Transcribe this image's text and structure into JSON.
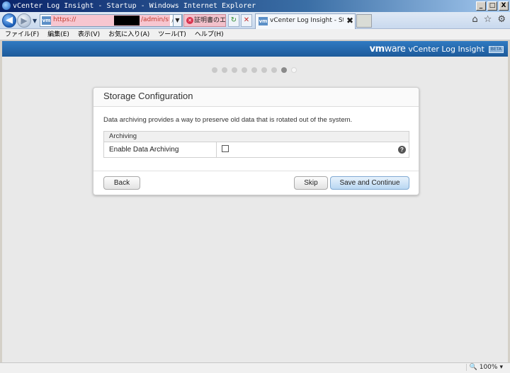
{
  "window": {
    "title": "vCenter Log Insight - Startup - Windows Internet Explorer",
    "min": "_",
    "max": "□",
    "close": "X"
  },
  "browser": {
    "url_prefix": "https://",
    "url_suffix": "/admin/startup#/admin/s",
    "search_glyph": "⌕",
    "cert_error": "証明書のエ...",
    "tab_title": "vCenter Log Insight - Start...",
    "tab_close": "✖",
    "vm_favicon": "vm",
    "icons": {
      "home": "home-icon",
      "star": "star-icon",
      "gear": "gear-icon"
    }
  },
  "menu": [
    "ファイル(F)",
    "編集(E)",
    "表示(V)",
    "お気に入り(A)",
    "ツール(T)",
    "ヘルプ(H)"
  ],
  "header": {
    "logo_vm": "vm",
    "logo_ware": "ware",
    "product": "vCenter Log Insight",
    "badge": "BETA",
    "accent": "#2a6fb6"
  },
  "wizard": {
    "total_steps": 9,
    "current_step": 8
  },
  "dialog": {
    "title": "Storage Configuration",
    "description": "Data archiving provides a way to preserve old data that is rotated out of the system.",
    "section": "Archiving",
    "setting_label": "Enable Data Archiving",
    "setting_checked": false,
    "help": "?",
    "buttons": {
      "back": "Back",
      "skip": "Skip",
      "save": "Save and Continue"
    }
  },
  "status": {
    "zoom": "100%"
  }
}
